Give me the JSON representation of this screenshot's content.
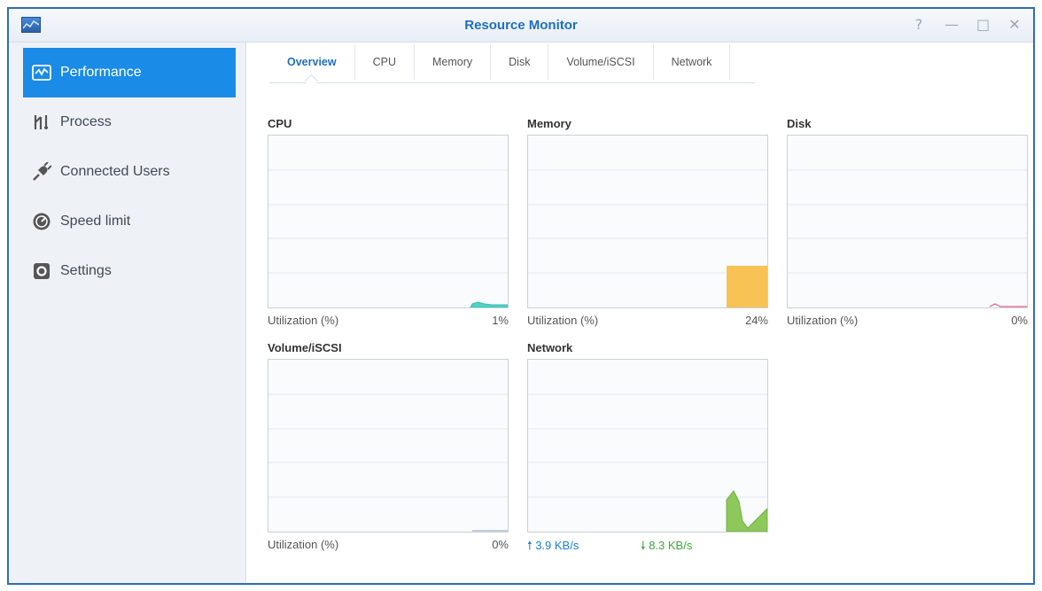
{
  "window": {
    "title": "Resource Monitor",
    "help_glyph": "?",
    "minimize_glyph": "—",
    "maximize_glyph": "□",
    "close_glyph": "✕"
  },
  "sidebar": {
    "items": [
      {
        "label": "Performance",
        "icon": "performance-icon",
        "active": true
      },
      {
        "label": "Process",
        "icon": "process-icon",
        "active": false
      },
      {
        "label": "Connected Users",
        "icon": "plug-icon",
        "active": false
      },
      {
        "label": "Speed limit",
        "icon": "speedometer-icon",
        "active": false
      },
      {
        "label": "Settings",
        "icon": "gear-icon",
        "active": false
      }
    ]
  },
  "tabs": [
    {
      "label": "Overview",
      "active": true
    },
    {
      "label": "CPU"
    },
    {
      "label": "Memory"
    },
    {
      "label": "Disk"
    },
    {
      "label": "Volume/iSCSI"
    },
    {
      "label": "Network"
    }
  ],
  "panels": {
    "cpu": {
      "title": "CPU",
      "label": "Utilization (%)",
      "value": "1%",
      "level": 1
    },
    "memory": {
      "title": "Memory",
      "label": "Utilization (%)",
      "value": "24%",
      "level": 24
    },
    "disk": {
      "title": "Disk",
      "label": "Utilization (%)",
      "value": "0%",
      "level": 0
    },
    "volume": {
      "title": "Volume/iSCSI",
      "label": "Utilization (%)",
      "value": "0%",
      "level": 0
    },
    "network": {
      "title": "Network",
      "upload": "3.9 KB/s",
      "download": "8.3 KB/s"
    }
  },
  "colors": {
    "accent": "#1a8be6",
    "title": "#1f6fc0",
    "cpu": "#4fd3c4",
    "memory": "#f8c254",
    "disk": "#e07a9a",
    "network": "#8cc85a",
    "upload": "#1a7fd6",
    "download": "#3ea83a"
  }
}
